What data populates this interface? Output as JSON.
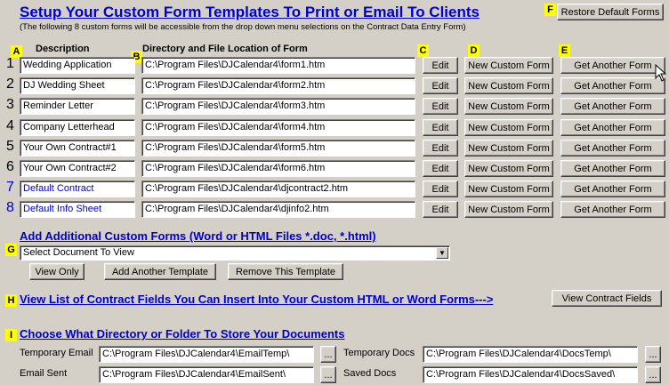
{
  "title": "Setup Your Custom Form Templates To Print or Email To Clients",
  "subtitle": "(The following 8 custom forms will be accessible from the drop down menu selections on the Contract Data Entry Form)",
  "restore_button": "Restore Default Forms",
  "markers": {
    "a": "A",
    "b": "B",
    "c": "C",
    "d": "D",
    "e": "E",
    "f": "F",
    "g": "G",
    "h": "H",
    "i": "I"
  },
  "headers": {
    "description": "Description",
    "location": "Directory and File Location of Form"
  },
  "row_buttons": {
    "edit": "Edit",
    "new_form": "New Custom Form",
    "get_form": "Get Another Form"
  },
  "rows": [
    {
      "num": "1",
      "description": "Wedding Application",
      "path": "C:\\Program Files\\DJCalendar4\\form1.htm",
      "blue": false
    },
    {
      "num": "2",
      "description": "DJ Wedding Sheet",
      "path": "C:\\Program Files\\DJCalendar4\\form2.htm",
      "blue": false
    },
    {
      "num": "3",
      "description": "Reminder Letter",
      "path": "C:\\Program Files\\DJCalendar4\\form3.htm",
      "blue": false
    },
    {
      "num": "4",
      "description": "Company Letterhead",
      "path": "C:\\Program Files\\DJCalendar4\\form4.htm",
      "blue": false
    },
    {
      "num": "5",
      "description": "Your Own Contract#1",
      "path": "C:\\Program Files\\DJCalendar4\\form5.htm",
      "blue": false
    },
    {
      "num": "6",
      "description": "Your Own Contract#2",
      "path": "C:\\Program Files\\DJCalendar4\\form6.htm",
      "blue": false
    },
    {
      "num": "7",
      "description": "Default Contract",
      "path": "C:\\Program Files\\DJCalendar4\\djcontract2.htm",
      "blue": true
    },
    {
      "num": "8",
      "description": "Default Info Sheet",
      "path": "C:\\Program Files\\DJCalendar4\\djinfo2.htm",
      "blue": true
    }
  ],
  "additional": {
    "heading": "Add Additional Custom Forms (Word or HTML Files  *.doc, *.html)",
    "select_value": "Select Document To View",
    "view_only": "View Only",
    "add_template": "Add Another Template",
    "remove_template": "Remove This Template"
  },
  "fields_link": {
    "heading": "View List of Contract Fields You Can Insert Into Your Custom HTML or Word Forms--->",
    "button": "View Contract Fields"
  },
  "storage": {
    "heading": "Choose What Directory or Folder To Store Your Documents",
    "browse": "...",
    "temp_email_label": "Temporary Email",
    "temp_email_path": "C:\\Program Files\\DJCalendar4\\EmailTemp\\",
    "email_sent_label": "Email Sent",
    "email_sent_path": "C:\\Program Files\\DJCalendar4\\EmailSent\\",
    "temp_docs_label": "Temporary Docs",
    "temp_docs_path": "C:\\Program Files\\DJCalendar4\\DocsTemp\\",
    "saved_docs_label": "Saved Docs",
    "saved_docs_path": "C:\\Program Files\\DJCalendar4\\DocsSaved\\"
  }
}
